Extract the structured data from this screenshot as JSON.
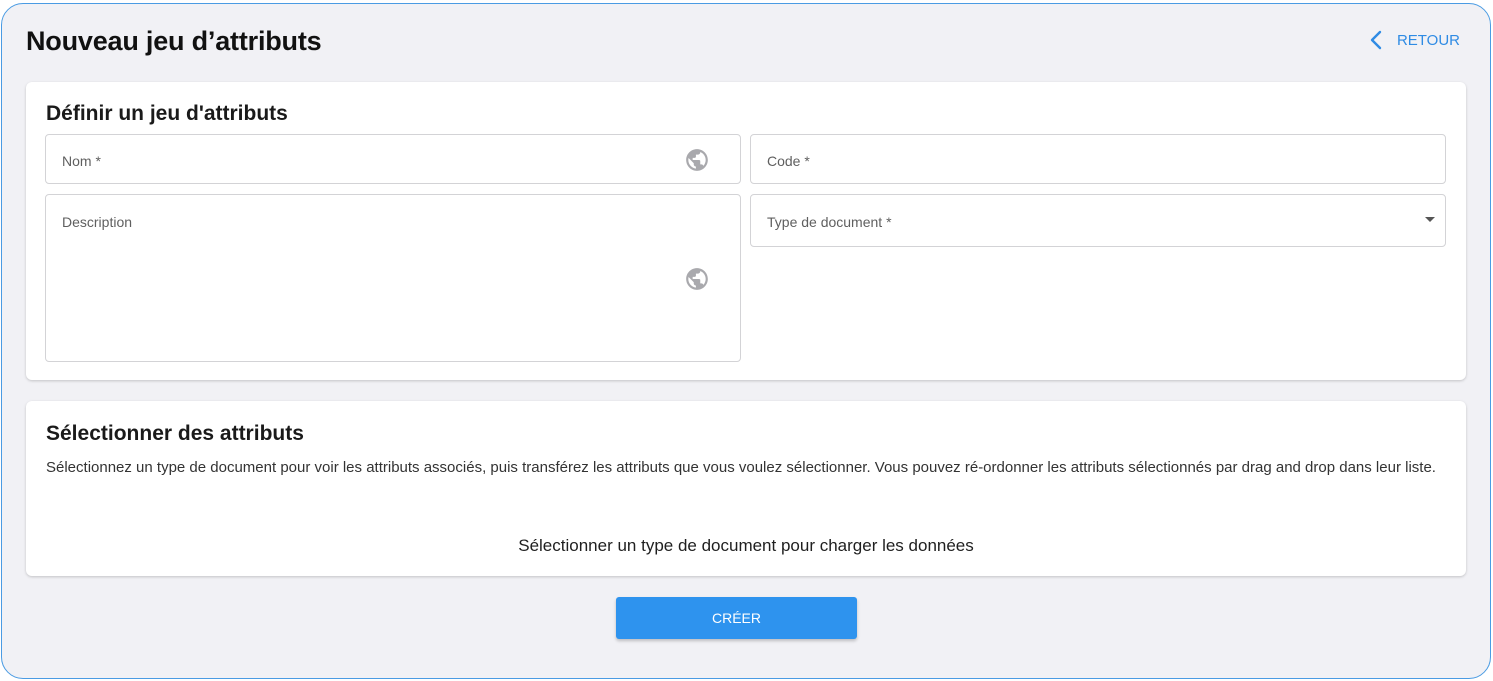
{
  "header": {
    "title": "Nouveau jeu d’attributs",
    "back_label": "RETOUR"
  },
  "define_section": {
    "title": "Définir un jeu d'attributs",
    "fields": {
      "name": {
        "label": "Nom *",
        "value": ""
      },
      "code": {
        "label": "Code *",
        "value": ""
      },
      "description": {
        "label": "Description",
        "value": ""
      },
      "document_type": {
        "label": "Type de document *",
        "selected": ""
      }
    }
  },
  "select_section": {
    "title": "Sélectionner des attributs",
    "description": "Sélectionnez un type de document pour voir les attributs associés, puis transférez les attributs que vous voulez sélectionner. Vous pouvez ré-ordonner les attributs sélectionnés par drag and drop dans leur liste.",
    "empty_message": "Sélectionner un type de document pour charger les données"
  },
  "actions": {
    "create_label": "CRÉER"
  },
  "colors": {
    "accent": "#2e93ee",
    "page_background": "#f1f1f5",
    "icon_gray": "#a9a9ad"
  },
  "icons": {
    "back": "chevron-left-icon",
    "translate": "globe-icon",
    "dropdown": "caret-down-icon"
  }
}
